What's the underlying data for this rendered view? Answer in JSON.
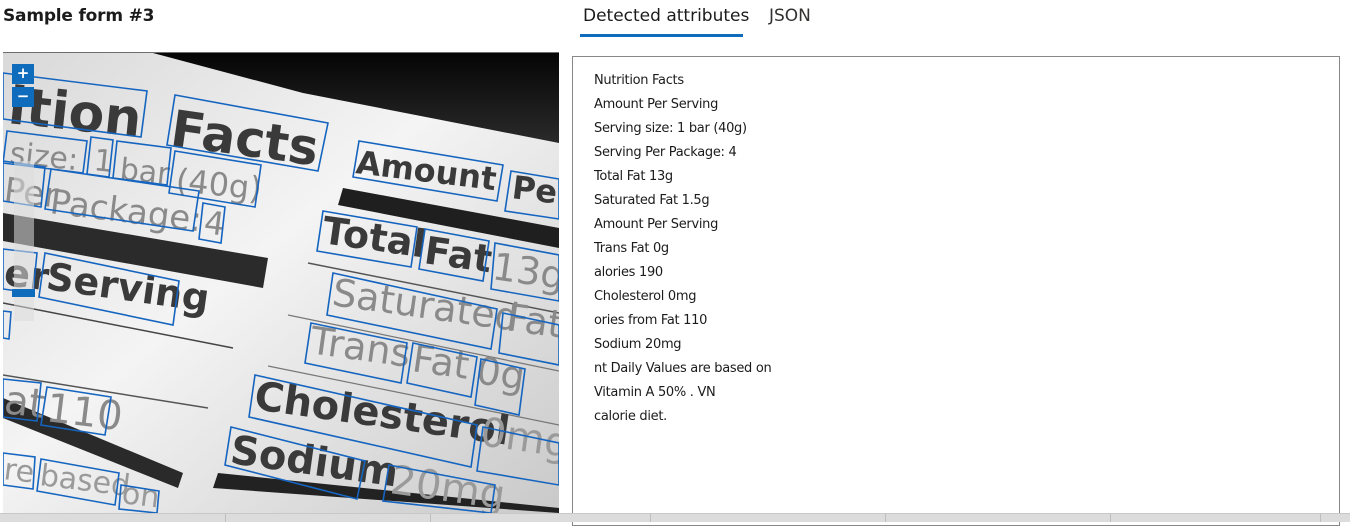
{
  "page": {
    "title": "Sample form #3"
  },
  "tabs": [
    {
      "label": "Detected attributes",
      "active": true
    },
    {
      "label": "JSON",
      "active": false
    }
  ],
  "viewer": {
    "zoom_in_label": "+",
    "zoom_out_label": "−",
    "box_color": "#1565c0",
    "photo_words": [
      "ition",
      "Facts",
      "size:",
      "1",
      "bar",
      "(40g)",
      "Amount",
      "Pe",
      "Per",
      "Package:",
      "4",
      "Total",
      "Fat",
      "13g",
      "er",
      "Serving",
      "Saturated",
      "Fat",
      "Trans",
      "Fat",
      "0g",
      "Cholesterol",
      "0mg",
      "at",
      "110",
      "Sodium",
      "20mg",
      "re",
      "based",
      "on"
    ]
  },
  "attributes": [
    "Nutrition Facts",
    "Amount Per Serving",
    "Serving size: 1 bar (40g)",
    "Serving Per Package: 4",
    "Total Fat 13g",
    "Saturated Fat 1.5g",
    "Amount Per Serving",
    "Trans Fat 0g",
    "alories 190",
    "Cholesterol 0mg",
    "ories from Fat 110",
    "Sodium 20mg",
    "nt Daily Values are based on",
    "Vitamin A 50% . VN",
    "calorie diet."
  ]
}
